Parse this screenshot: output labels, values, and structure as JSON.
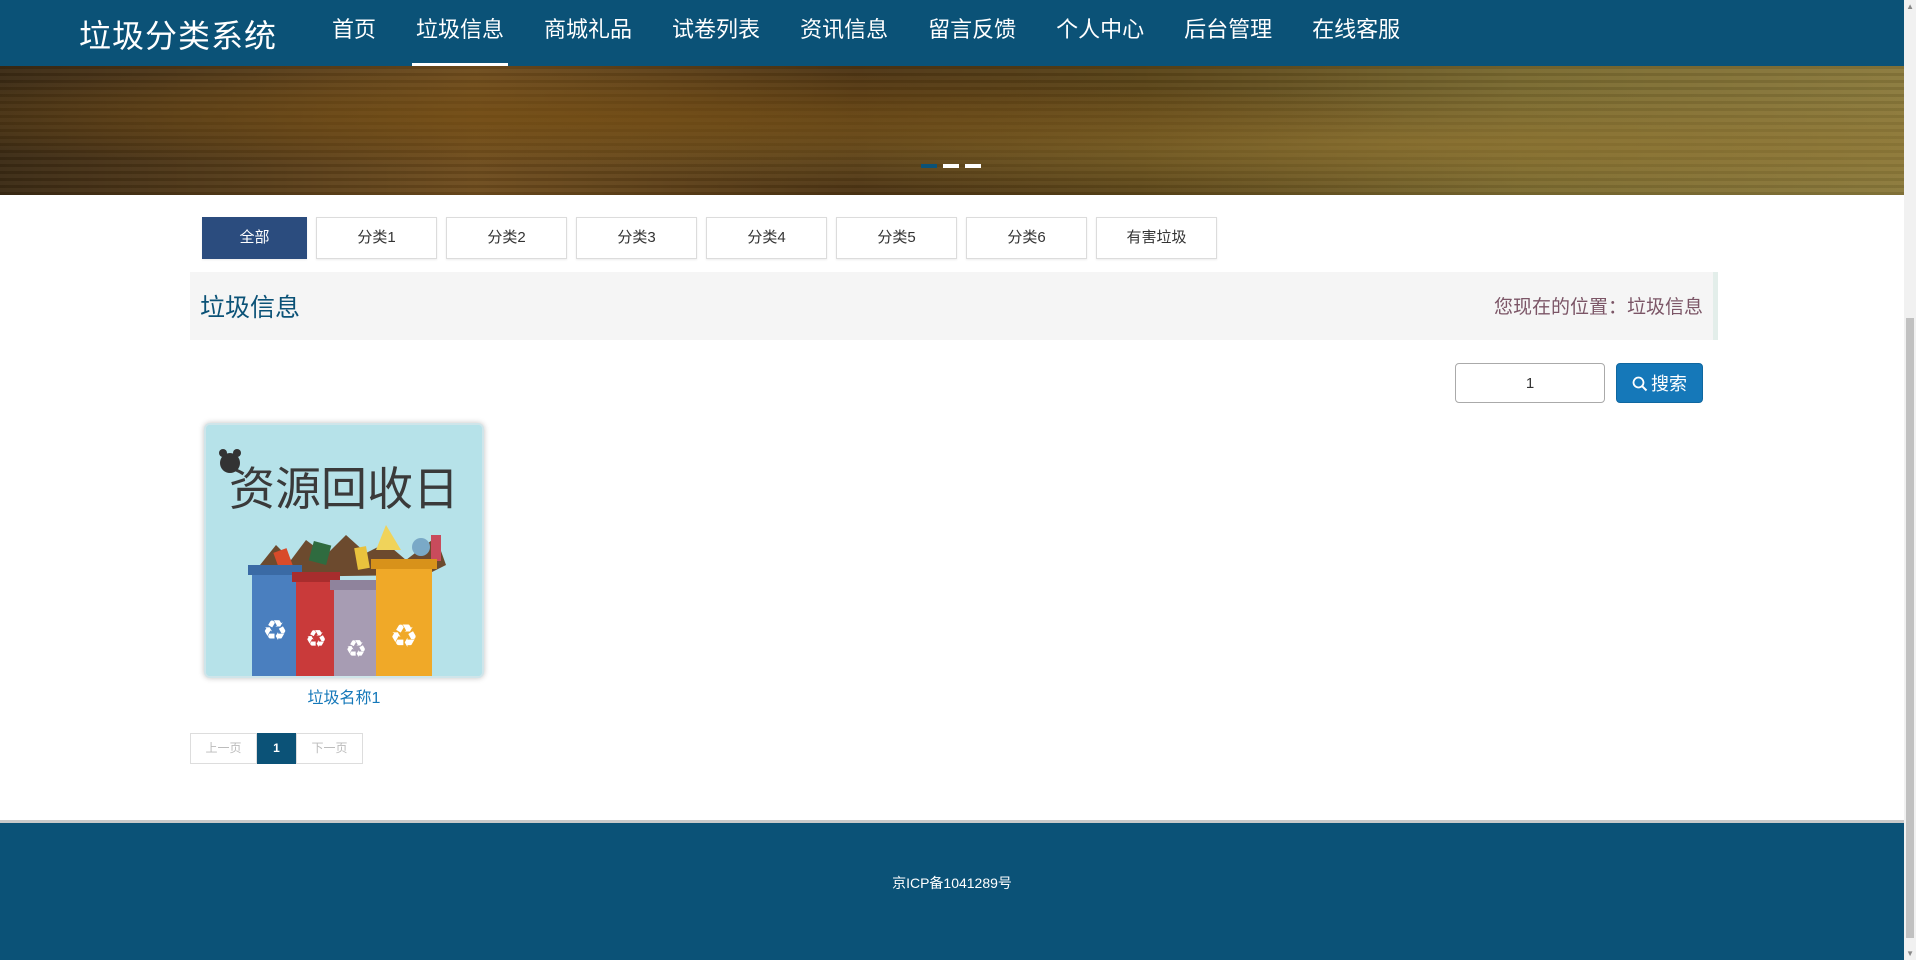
{
  "header": {
    "brand": "垃圾分类系统",
    "nav": [
      {
        "label": "首页"
      },
      {
        "label": "垃圾信息",
        "active": true
      },
      {
        "label": "商城礼品"
      },
      {
        "label": "试卷列表"
      },
      {
        "label": "资讯信息"
      },
      {
        "label": "留言反馈"
      },
      {
        "label": "个人中心"
      },
      {
        "label": "后台管理"
      },
      {
        "label": "在线客服"
      }
    ]
  },
  "banner": {
    "slide_count": 3,
    "active_slide": 1
  },
  "categories": [
    "全部",
    "分类1",
    "分类2",
    "分类3",
    "分类4",
    "分类5",
    "分类6",
    "有害垃圾"
  ],
  "section": {
    "title": "垃圾信息",
    "location": "您现在的位置：垃圾信息"
  },
  "search": {
    "value": "1",
    "button_label": "搜索"
  },
  "items": [
    {
      "name": "垃圾名称1",
      "image_text": "资源回收日"
    }
  ],
  "pagination": {
    "prev": "上一页",
    "current": "1",
    "next": "下一页"
  },
  "footer": {
    "icp": "京ICP备1041289号"
  },
  "colors": {
    "primary": "#0b5277",
    "button": "#1578b9",
    "tab_active": "#2b4c7e"
  }
}
